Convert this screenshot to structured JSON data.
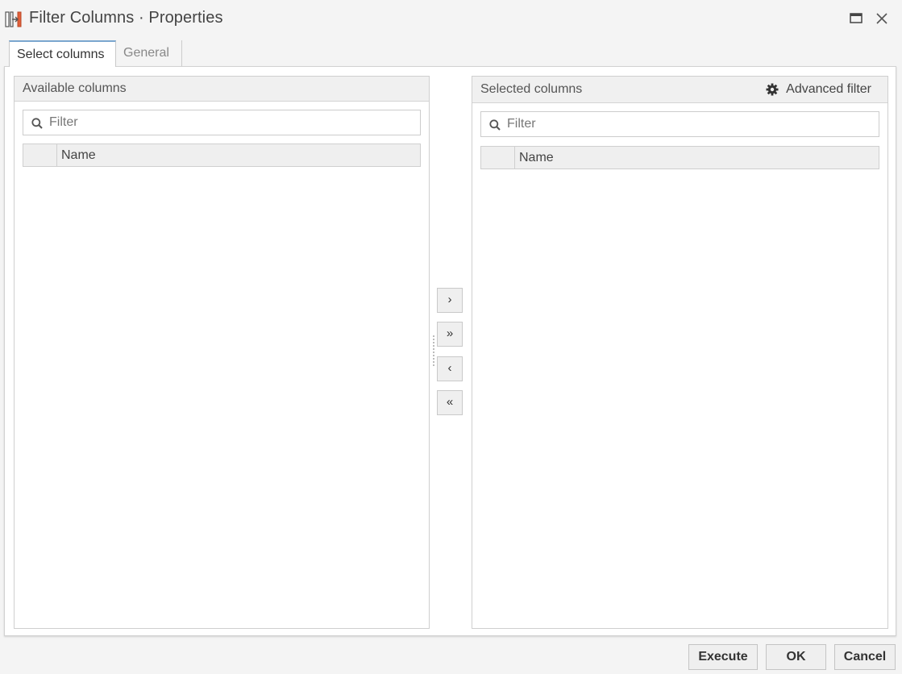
{
  "window": {
    "title": "Filter Columns · Properties",
    "icon": "filter-columns-app-icon"
  },
  "tabs": [
    {
      "label": "Select columns",
      "active": true
    },
    {
      "label": "General",
      "active": false
    }
  ],
  "available_panel": {
    "title": "Available columns",
    "filter_placeholder": "Filter",
    "filter_value": "",
    "column_header": "Name",
    "rows": []
  },
  "selected_panel": {
    "title": "Selected columns",
    "advanced_filter_label": "Advanced filter",
    "filter_placeholder": "Filter",
    "filter_value": "",
    "column_header": "Name",
    "rows": []
  },
  "move_buttons": {
    "add": "›",
    "add_all": "»",
    "remove": "‹",
    "remove_all": "«"
  },
  "footer": {
    "execute_label": "Execute",
    "ok_label": "OK",
    "cancel_label": "Cancel"
  }
}
